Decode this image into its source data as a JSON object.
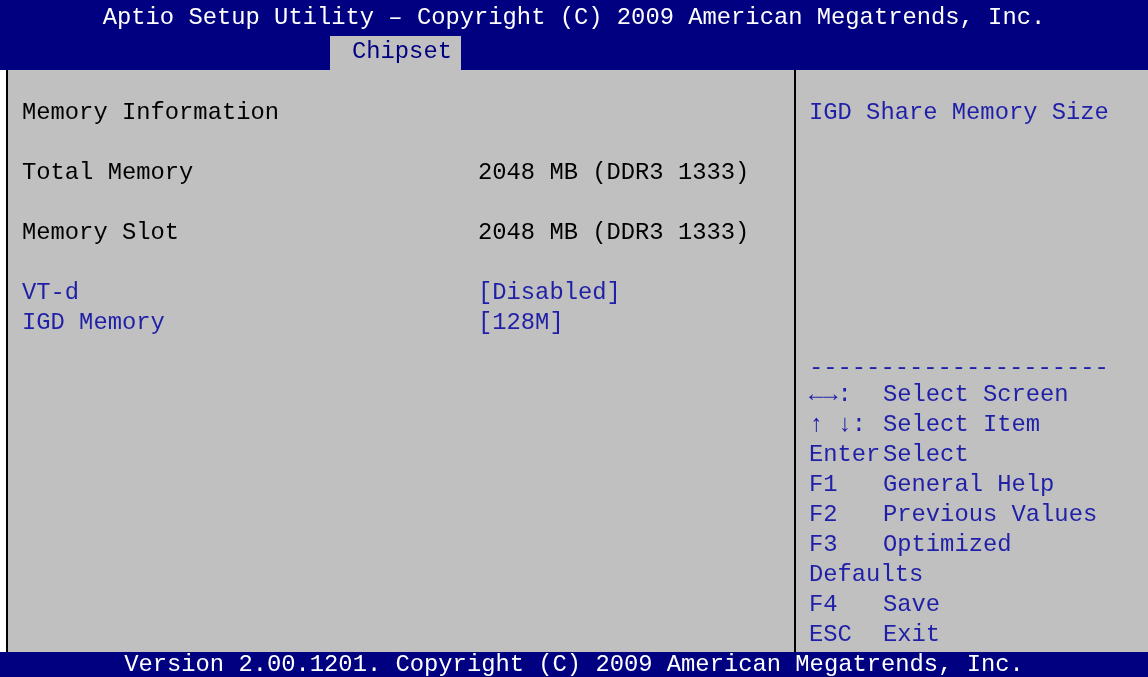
{
  "title": "Aptio Setup Utility – Copyright (C) 2009 American Megatrends, Inc.",
  "tabs": [
    {
      "label": "Chipset",
      "selected": true
    }
  ],
  "items": [
    {
      "kind": "heading",
      "label": "Memory Information"
    },
    {
      "kind": "info",
      "label": "Total Memory",
      "value": "2048 MB (DDR3 1333)"
    },
    {
      "kind": "info",
      "label": "Memory Slot",
      "value": "2048 MB (DDR3 1333)"
    },
    {
      "kind": "setting",
      "label": "VT-d",
      "value": "[Disabled]"
    },
    {
      "kind": "setting",
      "label": "IGD Memory",
      "value": "[128M]"
    }
  ],
  "help_text": "IGD Share Memory Size",
  "separator": "---------------------",
  "keys": [
    {
      "key": "←→:",
      "action": "Select Screen"
    },
    {
      "key": "↑ ↓:",
      "action": "Select Item"
    },
    {
      "key": "Enter",
      "action": "Select"
    },
    {
      "key": "F1",
      "action": "General Help"
    },
    {
      "key": "F2",
      "action": "Previous Values"
    },
    {
      "key": "F3",
      "action": "Optimized Defaults"
    },
    {
      "key": "F4",
      "action": "Save"
    },
    {
      "key": "ESC",
      "action": "Exit"
    }
  ],
  "footer": "Version 2.00.1201. Copyright (C) 2009 American Megatrends, Inc."
}
